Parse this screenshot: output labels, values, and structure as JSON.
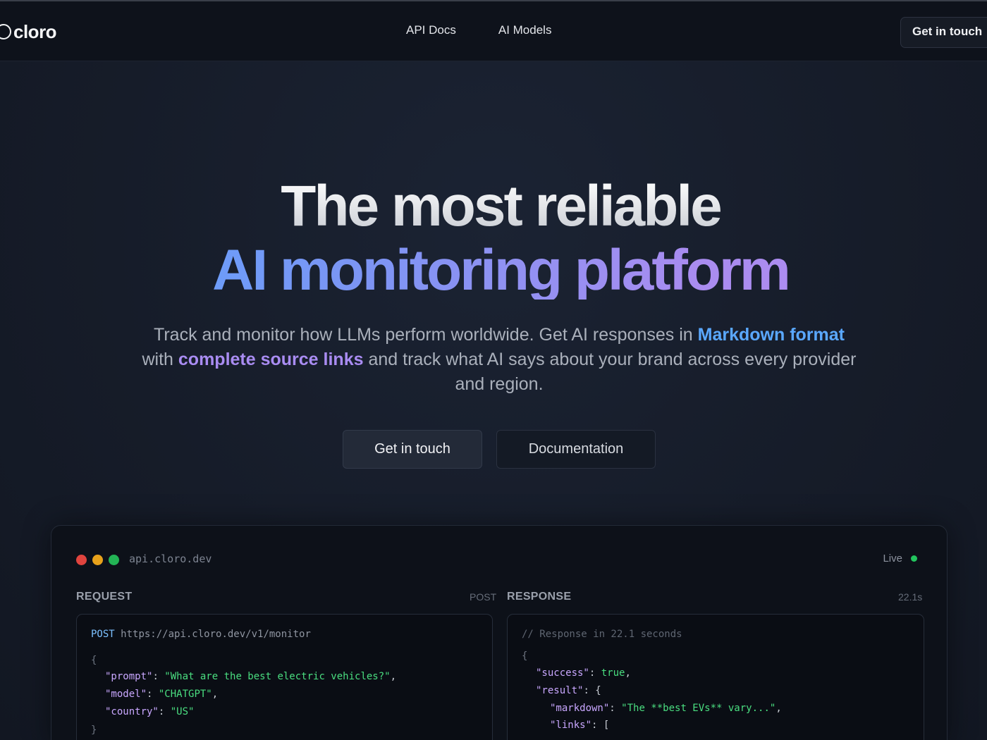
{
  "header": {
    "logo_text": "cloro",
    "nav": [
      "API Docs",
      "AI Models"
    ],
    "cta_label": "Get in touch"
  },
  "hero": {
    "title_line1": "The most reliable",
    "title_line2": "AI monitoring platform",
    "subtitle_part1": "Track and monitor how LLMs perform worldwide. Get AI responses in ",
    "subtitle_highlight1": "Markdown format",
    "subtitle_part2": " with ",
    "subtitle_highlight2": "complete source links",
    "subtitle_part3": " and track what AI says about your brand across every provider and region.",
    "primary_button": "Get in touch",
    "secondary_button": "Documentation"
  },
  "demo": {
    "url": "api.cloro.dev",
    "status": "Live",
    "request": {
      "label": "REQUEST",
      "method": "POST",
      "line_method": "POST",
      "endpoint": "https://api.cloro.dev/v1/monitor",
      "open": "{",
      "fields": [
        {
          "key": "\"prompt\"",
          "value": "\"What are the best electric vehicles?\"",
          "sep": ","
        },
        {
          "key": "\"model\"",
          "value": "\"CHATGPT\"",
          "sep": ","
        },
        {
          "key": "\"country\"",
          "value": "\"US\"",
          "sep": ""
        }
      ],
      "close": "}"
    },
    "response": {
      "label": "RESPONSE",
      "time": "22.1s",
      "comment": "// Response in 22.1 seconds",
      "open": "{",
      "success_key": "\"success\"",
      "success_value": "true",
      "result_key": "\"result\"",
      "markdown_key": "\"markdown\"",
      "markdown_value": "\"The **best EVs** vary...\"",
      "links_key": "\"links\""
    }
  },
  "colors": {
    "accent_blue": "#5aa8ff",
    "accent_purple": "#a98cf2",
    "live_green": "#22c55e"
  }
}
